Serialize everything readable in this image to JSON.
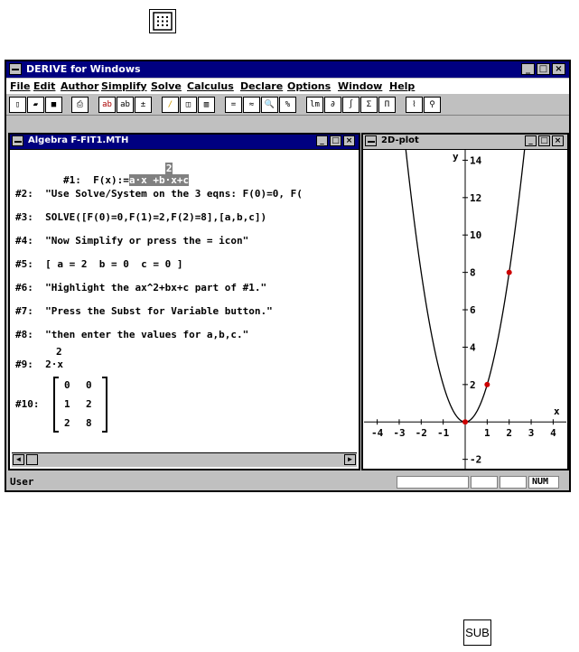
{
  "top_icon": {
    "name": "matrix-icon"
  },
  "bottom_icon": {
    "label": "SUB"
  },
  "window": {
    "title": "DERIVE for Windows",
    "menu": [
      "File",
      "Edit",
      "Author",
      "Simplify",
      "Solve",
      "Calculus",
      "Declare",
      "Options",
      "Window",
      "Help"
    ],
    "toolbar": [
      "",
      "",
      "",
      "",
      "ab",
      "ab",
      "",
      "",
      "",
      "",
      "=",
      "≈",
      "",
      "",
      "lm",
      "∂",
      "∫",
      "Σ",
      "Π",
      "",
      ""
    ]
  },
  "algebra": {
    "title": "Algebra  F-FIT1.MTH",
    "lines": [
      {
        "label": "#1:",
        "expr": "F(x):=",
        "highlight": "a·x +b·x+c",
        "sup": "2"
      },
      {
        "label": "#2:",
        "expr": "\"Use Solve/System on the 3 eqns: F(0)=0, F("
      },
      {
        "label": "#3:",
        "expr": "SOLVE([F(0)=0,F(1)=2,F(2)=8],[a,b,c])"
      },
      {
        "label": "#4:",
        "expr": "\"Now Simplify or press the = icon\""
      },
      {
        "label": "#5:",
        "expr": "[ a = 2  b = 0  c = 0 ]"
      },
      {
        "label": "#6:",
        "expr": "\"Highlight the ax^2+bx+c part of #1.\""
      },
      {
        "label": "#7:",
        "expr": "\"Press the Subst for Variable button.\""
      },
      {
        "label": "#8:",
        "expr": "\"then enter the values for a,b,c.\""
      },
      {
        "label": "#9:",
        "expr": "2·x",
        "sup": "2"
      },
      {
        "label": "#10:",
        "matrix": [
          [
            "0",
            "0"
          ],
          [
            "1",
            "2"
          ],
          [
            "2",
            "8"
          ]
        ]
      }
    ]
  },
  "plot": {
    "title": "2D-plot",
    "x_label": "x",
    "y_label": "y",
    "x_ticks": [
      "-4",
      "-3",
      "-2",
      "-1",
      "1",
      "2",
      "3",
      "4"
    ],
    "y_ticks": [
      "14",
      "12",
      "10",
      "8",
      "6",
      "4",
      "2",
      "-2"
    ],
    "points": [
      [
        0,
        0
      ],
      [
        1,
        2
      ],
      [
        2,
        8
      ]
    ],
    "curve": "2x^2",
    "point_color": "#cc0000"
  },
  "status": {
    "mode": "User",
    "num": "NUM"
  }
}
